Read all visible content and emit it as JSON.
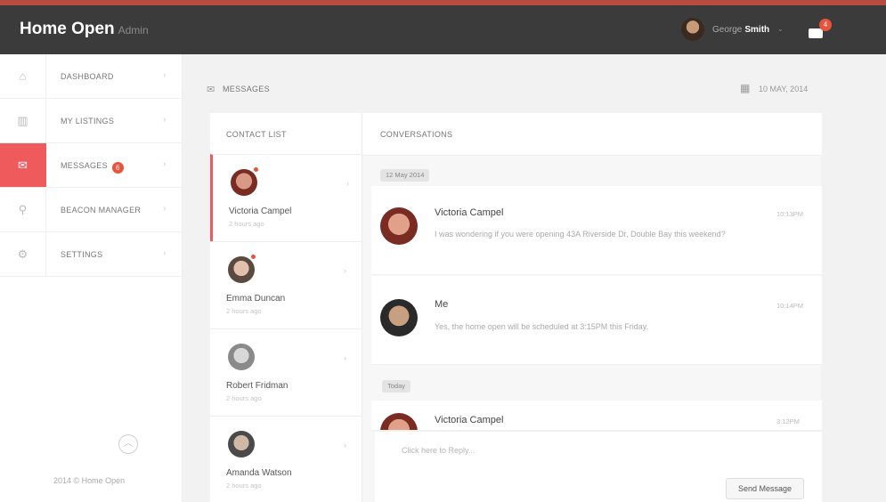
{
  "header": {
    "brand": "Home Open",
    "brand_sub": "Admin",
    "user_first": "George",
    "user_last": "Smith",
    "notifications": "4"
  },
  "sidebar": {
    "items": [
      {
        "label": "DASHBOARD",
        "icon": "home-icon"
      },
      {
        "label": "MY LISTINGS",
        "icon": "building-icon"
      },
      {
        "label": "MESSAGES",
        "icon": "mail-icon",
        "badge": "6",
        "active": true
      },
      {
        "label": "BEACON MANAGER",
        "icon": "beacon-icon"
      },
      {
        "label": "SETTINGS",
        "icon": "gear-icon"
      }
    ],
    "footer": "2014 © Home Open"
  },
  "page": {
    "title": "MESSAGES",
    "date": "10 MAY, 2014"
  },
  "contacts": {
    "heading": "CONTACT LIST",
    "items": [
      {
        "name": "Victoria Campel",
        "time": "2 hours ago",
        "unread": true
      },
      {
        "name": "Emma Duncan",
        "time": "2 hours ago",
        "unread": true
      },
      {
        "name": "Robert Fridman",
        "time": "2 hours ago",
        "unread": false
      },
      {
        "name": "Amanda Watson",
        "time": "2 hours ago",
        "unread": false
      }
    ]
  },
  "conversation": {
    "heading": "CONVERSATIONS",
    "date_1": "12 May 2014",
    "date_2": "Today",
    "messages": [
      {
        "name": "Victoria Campel",
        "time": "10:13PM",
        "text": "I was wondering if you were opening 43A Riverside Dr, Double Bay this weekend?"
      },
      {
        "name": "Me",
        "time": "10:14PM",
        "text": "Yes, the home open will be scheduled at 3:15PM this Friday."
      },
      {
        "name": "Victoria Campel",
        "time": "3:12PM",
        "text": ""
      }
    ],
    "reply_placeholder": "Click here to Reply...",
    "send_label": "Send Message"
  },
  "colors": {
    "accent": "#ef5a5d",
    "header_bg": "#3b3b3b",
    "badge": "#e8533c"
  }
}
